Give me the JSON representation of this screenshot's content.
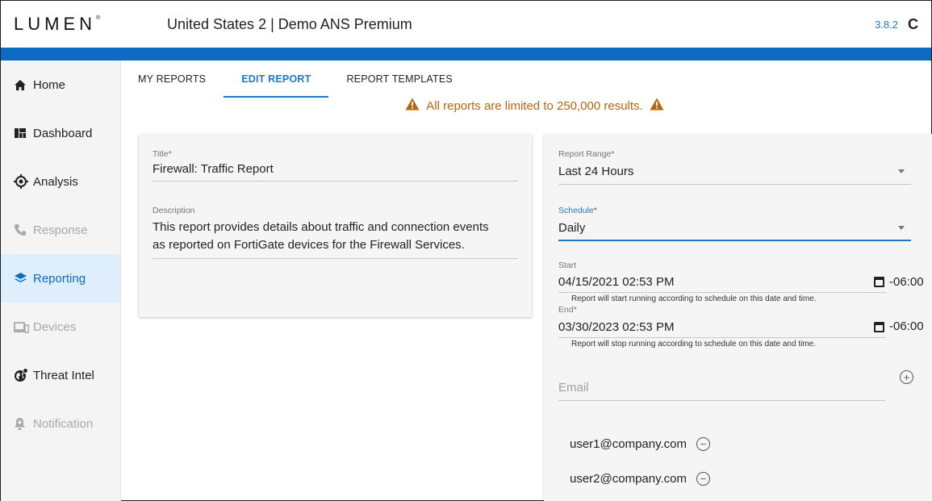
{
  "header": {
    "logo": "LUMEN",
    "logo_mark": "®",
    "title": "United States 2 | Demo ANS Premium",
    "version": "3.8.2",
    "refresh_glyph": "C"
  },
  "sidebar": {
    "items": [
      {
        "label": "Home",
        "icon": "home-icon",
        "state": "normal"
      },
      {
        "label": "Dashboard",
        "icon": "dashboard-icon",
        "state": "normal"
      },
      {
        "label": "Analysis",
        "icon": "target-icon",
        "state": "normal"
      },
      {
        "label": "Response",
        "icon": "phone-icon",
        "state": "disabled"
      },
      {
        "label": "Reporting",
        "icon": "layers-icon",
        "state": "active"
      },
      {
        "label": "Devices",
        "icon": "devices-icon",
        "state": "disabled"
      },
      {
        "label": "Threat Intel",
        "icon": "globe-icon",
        "state": "normal"
      },
      {
        "label": "Notification",
        "icon": "bell-icon",
        "state": "disabled"
      }
    ]
  },
  "tabs": [
    {
      "label": "MY REPORTS",
      "active": false
    },
    {
      "label": "EDIT REPORT",
      "active": true
    },
    {
      "label": "REPORT TEMPLATES",
      "active": false
    }
  ],
  "warning": {
    "text": "All reports are limited to 250,000 results.",
    "color": "#b8660c"
  },
  "form": {
    "title_label": "Title",
    "title_value": "Firewall: Traffic Report",
    "description_label": "Description",
    "description_line1": "This report provides details about traffic and connection events",
    "description_line2": "as reported on FortiGate devices for the Firewall Services.",
    "range_label": "Report Range",
    "range_value": "Last 24 Hours",
    "schedule_label": "Schedule",
    "schedule_value": "Daily",
    "start_label": "Start",
    "start_value": "04/15/2021 02:53 PM",
    "start_tz": "-06:00",
    "start_hint": "Report will start running according to schedule on this date and time.",
    "end_label": "End",
    "end_value": "03/30/2023 02:53 PM",
    "end_tz": "-06:00",
    "end_hint": "Report will stop running according to schedule on this date and time.",
    "email_placeholder": "Email",
    "required_mark": "*",
    "emails": [
      "user1@company.com",
      "user2@company.com"
    ]
  },
  "colors": {
    "accent": "#1f78c8",
    "brand_bar": "#0e6bc4",
    "active_nav_bg": "#dfeefc"
  }
}
